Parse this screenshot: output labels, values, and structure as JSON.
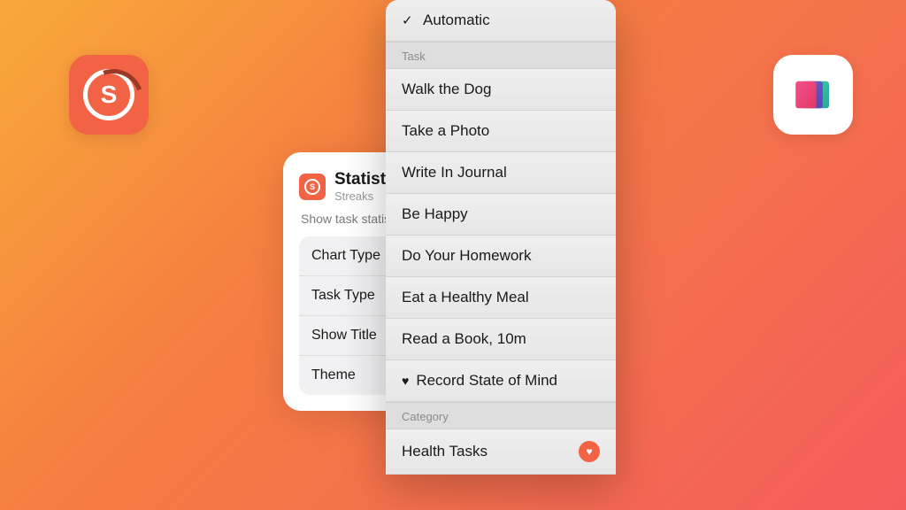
{
  "streaks_app": {
    "letter": "S"
  },
  "widget": {
    "title": "Statistics",
    "subtitle": "Streaks",
    "description": "Show task statistics",
    "options": [
      "Chart Type",
      "Task Type",
      "Show Title",
      "Theme"
    ]
  },
  "dropdown": {
    "selected": "Automatic",
    "sections": [
      {
        "header": "Task",
        "items": [
          {
            "label": "Walk the Dog",
            "icon": null
          },
          {
            "label": "Take a Photo",
            "icon": null
          },
          {
            "label": "Write In Journal",
            "icon": null
          },
          {
            "label": "Be Happy",
            "icon": null
          },
          {
            "label": "Do Your Homework",
            "icon": null
          },
          {
            "label": "Eat a Healthy Meal",
            "icon": null
          },
          {
            "label": "Read a Book, 10m",
            "icon": null
          },
          {
            "label": "Record State of Mind",
            "icon": "heart"
          }
        ]
      },
      {
        "header": "Category",
        "items": [
          {
            "label": "Health Tasks",
            "badge": "heart"
          }
        ]
      }
    ]
  }
}
